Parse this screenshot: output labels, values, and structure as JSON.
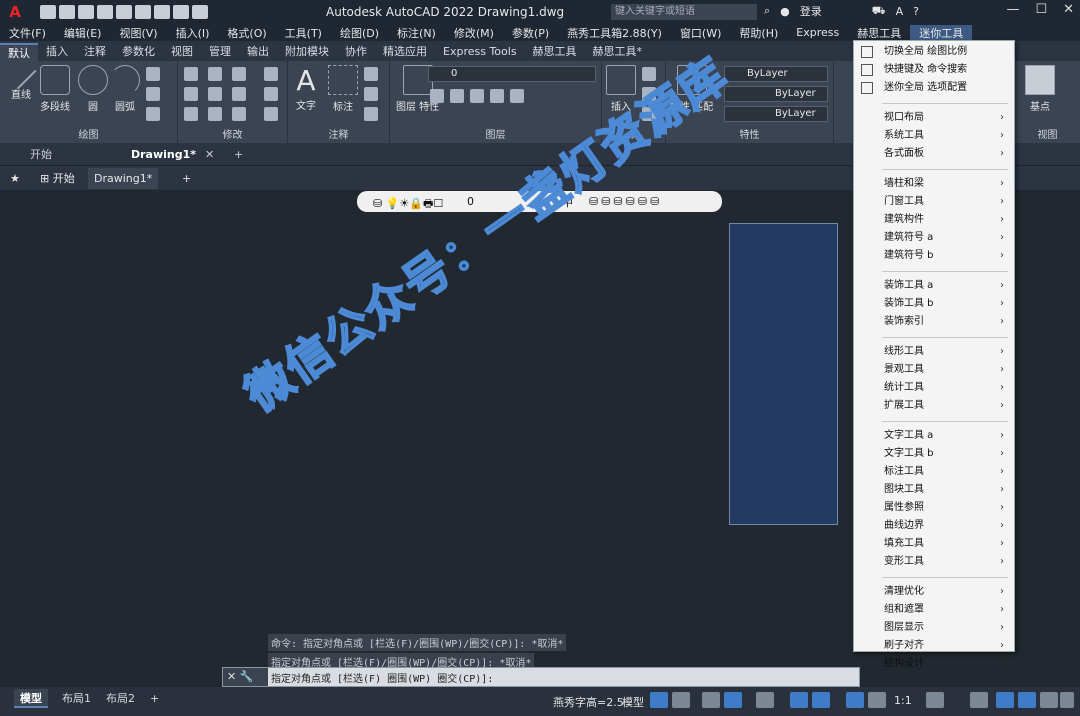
{
  "titlebar": {
    "logo": "A",
    "title": "Autodesk AutoCAD 2022    Drawing1.dwg",
    "search_placeholder": "键入关键字或短语",
    "login": "登录",
    "help": "?"
  },
  "menubar": [
    "文件(F)",
    "编辑(E)",
    "视图(V)",
    "插入(I)",
    "格式(O)",
    "工具(T)",
    "绘图(D)",
    "标注(N)",
    "修改(M)",
    "参数(P)",
    "燕秀工具箱2.88(Y)",
    "窗口(W)",
    "帮助(H)",
    "Express",
    "赫思工具",
    "迷你工具"
  ],
  "ribbon_tabs": [
    "默认",
    "插入",
    "注释",
    "参数化",
    "视图",
    "管理",
    "输出",
    "附加模块",
    "协作",
    "精选应用",
    "Express Tools",
    "赫思工具",
    "赫思工具*"
  ],
  "ribbon": {
    "draw_buttons": [
      "直线",
      "多段线",
      "圆",
      "圆弧"
    ],
    "draw_label": "绘图",
    "modify_label": "修改",
    "text_button": "文字",
    "dim_button": "标注",
    "annot_label": "注释",
    "layer_button": "图层\n特性",
    "layer_value": "0",
    "layer_label": "图层",
    "insert_button": "插入",
    "block_label": "块",
    "props_button": "特性\n匹配",
    "bylayer1": "ByLayer",
    "bylayer2": "ByLayer",
    "bylayer3": "ByLayer",
    "props_label": "特性",
    "base_button": "基点",
    "view_label": "视图"
  },
  "doctabs": {
    "start": "开始",
    "drawing": "Drawing1*",
    "close": "✕",
    "add": "+"
  },
  "filetabs": {
    "start": "开始",
    "drawing": "Drawing1*",
    "add": "+"
  },
  "layer_toolbar": {
    "value": "0",
    "center": "中"
  },
  "watermark": "微信公众号：一盏灯资源库",
  "command": {
    "history1": "命令: 指定对角点或 [栏选(F)/圈围(WP)/圈交(CP)]: *取消*",
    "history2": "指定对角点或 [栏选(F)/圈围(WP)/圈交(CP)]: *取消*",
    "prompt": "指定对角点或 [栏选(F) 圈围(WP) 圈交(CP)]:"
  },
  "statusbar": {
    "tabs": [
      "模型",
      "布局1",
      "布局2"
    ],
    "add": "+",
    "text_height": "燕秀字高=2.5",
    "model": "模型",
    "scale": "1:1"
  },
  "dropdown": {
    "top_items": [
      "切换全局 绘图比例",
      "快捷键及 命令搜索",
      "迷你全局 选项配置"
    ],
    "groups": [
      [
        "视口布局",
        "系统工具",
        "各式面板"
      ],
      [
        "墙柱和梁",
        "门窗工具",
        "建筑构件",
        "建筑符号 a",
        "建筑符号 b"
      ],
      [
        "装饰工具 a",
        "装饰工具 b",
        "装饰索引"
      ],
      [
        "线形工具",
        "景观工具",
        "统计工具",
        "扩展工具"
      ],
      [
        "文字工具 a",
        "文字工具 b",
        "标注工具",
        "图块工具",
        "属性参照",
        "曲线边界",
        "填充工具",
        "变形工具"
      ],
      [
        "清理优化",
        "组和遮罩",
        "图层显示",
        "刷子对齐",
        "结构设计"
      ]
    ],
    "arrow": "›"
  }
}
